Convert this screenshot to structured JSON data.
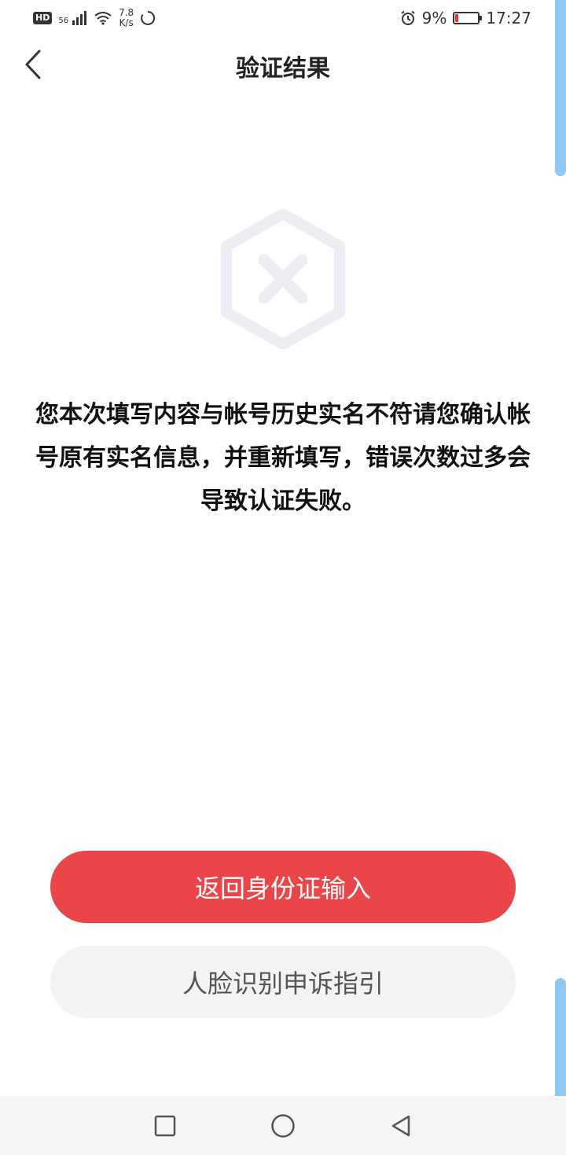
{
  "status_bar": {
    "hd": "HD",
    "network": "56",
    "speed_value": "7.8",
    "speed_unit": "K/s",
    "battery_percent": "9%",
    "time": "17:27",
    "battery_level": 0.09
  },
  "header": {
    "title": "验证结果",
    "back_icon": "chevron-left-icon"
  },
  "result": {
    "icon": "error-hexagon-icon",
    "message": "您本次填写内容与帐号历史实名不符请您确认帐号原有实名信息，并重新填写，错误次数过多会导致认证失败。"
  },
  "actions": {
    "primary_label": "返回身份证输入",
    "secondary_label": "人脸识别申诉指引"
  },
  "colors": {
    "primary": "#ea4548",
    "secondary_bg": "#f3f3f3",
    "icon_gray": "#eceef3",
    "scroll_indicator": "#8ec9f5"
  },
  "system_nav": {
    "recents_icon": "square-icon",
    "home_icon": "circle-icon",
    "back_icon": "triangle-back-icon"
  }
}
